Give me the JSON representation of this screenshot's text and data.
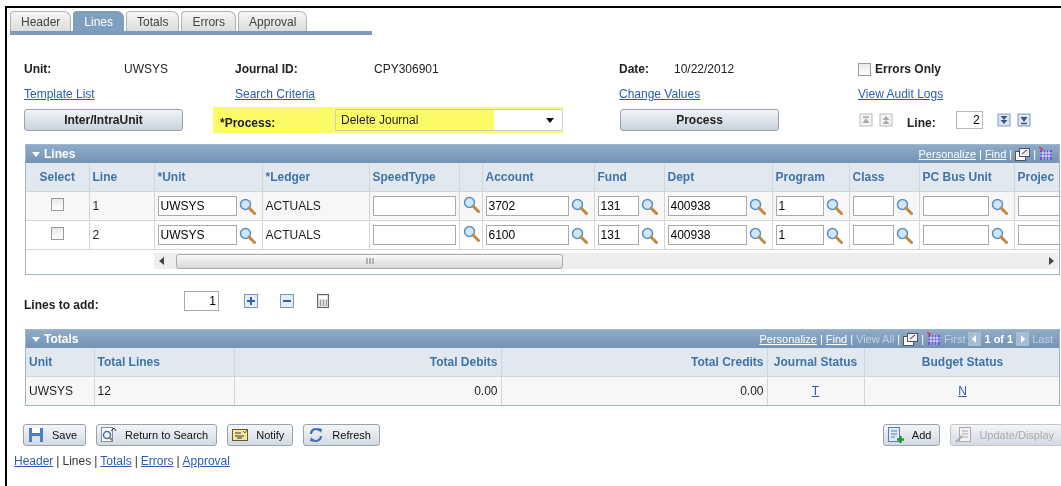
{
  "tabs": [
    {
      "label": "Header",
      "selected": false
    },
    {
      "label": "Lines",
      "selected": true
    },
    {
      "label": "Totals",
      "selected": false
    },
    {
      "label": "Errors",
      "selected": false
    },
    {
      "label": "Approval",
      "selected": false
    }
  ],
  "header": {
    "unit": {
      "label": "Unit:",
      "value": "UWSYS"
    },
    "journal_id": {
      "label": "Journal ID:",
      "value": "CPY306901"
    },
    "date": {
      "label": "Date:",
      "value": "10/22/2012"
    },
    "errors_only": {
      "label": "Errors Only",
      "checked": false
    },
    "links": [
      "Template List",
      "Search Criteria",
      "Change Values",
      "View Audit Logs"
    ],
    "interunit_button": "Inter/IntraUnit",
    "process": {
      "label": "*Process:",
      "value": "Delete Journal",
      "highlighted": true
    },
    "process_button": "Process",
    "line_nav": {
      "back": [
        {
          "kind": "first",
          "disabled": true
        },
        {
          "kind": "previous",
          "disabled": true
        }
      ],
      "label": "Line:",
      "value": "2",
      "forward": [
        {
          "kind": "next",
          "disabled": false
        },
        {
          "kind": "last",
          "disabled": false
        }
      ]
    }
  },
  "lines_grid": {
    "title": "Lines",
    "toolbar": [
      {
        "kind": "link",
        "text": "Personalize"
      },
      {
        "kind": "separator",
        "text": "|"
      },
      {
        "kind": "link",
        "text": "Find"
      },
      {
        "kind": "separator",
        "text": "|"
      },
      {
        "kind": "window"
      },
      {
        "kind": "separator",
        "text": "|"
      },
      {
        "kind": "grid"
      }
    ],
    "columns": [
      {
        "label": "Select",
        "kind": "center"
      },
      {
        "label": "Line"
      },
      {
        "label": "*Unit"
      },
      {
        "label": "*Ledger"
      },
      {
        "label": "SpeedType"
      },
      {},
      {
        "label": "Account"
      },
      {
        "label": "Fund"
      },
      {
        "label": "Dept"
      },
      {
        "label": "Program"
      },
      {
        "label": "Class"
      },
      {
        "label": "PC Bus Unit"
      },
      {
        "label": "Projec"
      }
    ],
    "rows": [
      {
        "selected": false,
        "cells": [
          {
            "kind": "select"
          },
          {
            "kind": "text",
            "value": "1"
          },
          {
            "kind": "lookup-input",
            "value": "UWSYS"
          },
          {
            "kind": "text",
            "value": "ACTUALS"
          },
          {
            "kind": "input"
          },
          {
            "kind": "lookup"
          },
          {
            "kind": "lookup-input",
            "value": "3702"
          },
          {
            "kind": "lookup-input",
            "value": "131"
          },
          {
            "kind": "lookup-input",
            "value": "400938"
          },
          {
            "kind": "lookup-input",
            "value": "1"
          },
          {
            "kind": "lookup-input"
          },
          {
            "kind": "lookup-input"
          },
          {
            "kind": "input"
          }
        ]
      },
      {
        "selected": false,
        "cells": [
          {
            "kind": "select"
          },
          {
            "kind": "text",
            "value": "2"
          },
          {
            "kind": "lookup-input",
            "value": "UWSYS"
          },
          {
            "kind": "text",
            "value": "ACTUALS"
          },
          {
            "kind": "input"
          },
          {
            "kind": "lookup"
          },
          {
            "kind": "lookup-input",
            "value": "6100"
          },
          {
            "kind": "lookup-input",
            "value": "131"
          },
          {
            "kind": "lookup-input",
            "value": "400938"
          },
          {
            "kind": "lookup-input",
            "value": "1"
          },
          {
            "kind": "lookup-input"
          },
          {
            "kind": "lookup-input"
          },
          {
            "kind": "input"
          }
        ]
      }
    ]
  },
  "lines_to_add": {
    "label": "Lines to add:",
    "value": "1"
  },
  "totals_grid": {
    "title": "Totals",
    "toolbar": [
      {
        "kind": "link",
        "text": "Personalize"
      },
      {
        "kind": "separator",
        "text": "|"
      },
      {
        "kind": "link",
        "text": "Find"
      },
      {
        "kind": "separator",
        "text": "|"
      },
      {
        "kind": "link",
        "text": "View All",
        "disabled": true
      },
      {
        "kind": "separator",
        "text": "|"
      },
      {
        "kind": "window"
      },
      {
        "kind": "separator",
        "text": "|"
      },
      {
        "kind": "grid"
      },
      {
        "kind": "link",
        "text": "First",
        "disabled": true
      },
      {
        "kind": "prev",
        "disabled": true
      },
      {
        "kind": "count",
        "text": "1 of 1"
      },
      {
        "kind": "next",
        "disabled": true
      },
      {
        "kind": "link",
        "text": "Last",
        "disabled": true
      }
    ],
    "columns": [
      {
        "label": "Unit"
      },
      {
        "label": "Total Lines"
      },
      {
        "label": "Total Debits",
        "kind": "amount"
      },
      {
        "label": "Total Credits",
        "kind": "amount"
      },
      {
        "label": "Journal Status",
        "kind": "center"
      },
      {
        "label": "Budget Status",
        "kind": "center"
      }
    ],
    "rows": [
      {
        "cells": [
          {
            "kind": "text",
            "value": "UWSYS"
          },
          {
            "kind": "text",
            "value": "12"
          },
          {
            "kind": "text",
            "value": "0.00"
          },
          {
            "kind": "text",
            "value": "0.00"
          },
          {
            "kind": "link",
            "value": "T"
          },
          {
            "kind": "link",
            "value": "N"
          }
        ]
      }
    ]
  },
  "buttons_left": [
    {
      "kind": "save",
      "label": "Save",
      "disabled": false
    },
    {
      "kind": "return",
      "label": "Return to Search",
      "disabled": false
    },
    {
      "kind": "notify",
      "label": "Notify",
      "disabled": false
    },
    {
      "kind": "refresh",
      "label": "Refresh",
      "disabled": false
    }
  ],
  "buttons_right": [
    {
      "kind": "add",
      "label": "Add",
      "disabled": false
    },
    {
      "kind": "update",
      "label": "Update/Display",
      "disabled": true
    }
  ],
  "page_links": {
    "separator": "|",
    "items": [
      {
        "label": "Header",
        "selected": false
      },
      {
        "label": "Lines",
        "selected": true
      },
      {
        "label": "Totals",
        "selected": false
      },
      {
        "label": "Errors",
        "selected": false
      },
      {
        "label": "Approval",
        "selected": false
      }
    ]
  }
}
